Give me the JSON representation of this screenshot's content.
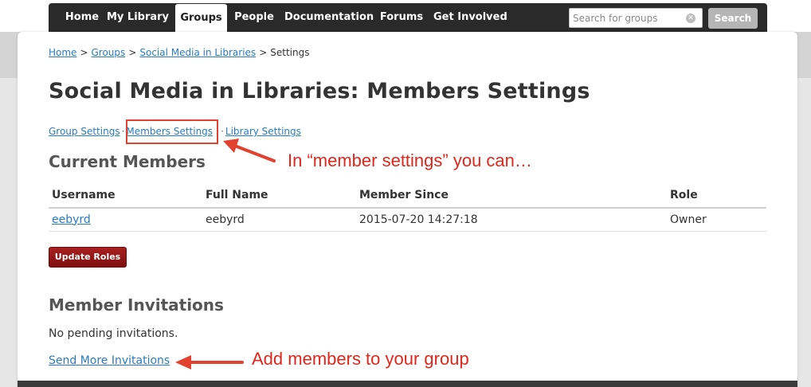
{
  "nav": {
    "tabs": [
      {
        "label": "Home"
      },
      {
        "label": "My Library"
      },
      {
        "label": "Groups"
      },
      {
        "label": "People"
      },
      {
        "label": "Documentation"
      },
      {
        "label": "Forums"
      },
      {
        "label": "Get Involved"
      }
    ],
    "active_tab": "Groups",
    "search_placeholder": "Search for groups",
    "search_button": "Search"
  },
  "breadcrumb": {
    "items": [
      "Home",
      "Groups",
      "Social Media in Libraries",
      "Settings"
    ],
    "separator": ">"
  },
  "page_title": "Social Media in Libraries: Members Settings",
  "subnav": {
    "items": [
      "Group Settings",
      "Members Settings",
      "Library Settings"
    ],
    "separator": "·"
  },
  "current_members": {
    "title": "Current Members",
    "columns": [
      "Username",
      "Full Name",
      "Member Since",
      "Role"
    ],
    "rows": [
      {
        "username": "eebyrd",
        "full_name": "eebyrd",
        "member_since": "2015-07-20 14:27:18",
        "role": "Owner"
      }
    ],
    "update_button": "Update Roles"
  },
  "invitations": {
    "title": "Member Invitations",
    "status": "No pending invitations.",
    "send_link": "Send More Invitations"
  },
  "annotations": {
    "member_settings": "In “member settings” you can…",
    "add_members": "Add members to your group",
    "color": "#e1261c"
  },
  "colors": {
    "navbar": "#2a2a2a",
    "link": "#2a7bc0",
    "button": "#8e1414"
  }
}
